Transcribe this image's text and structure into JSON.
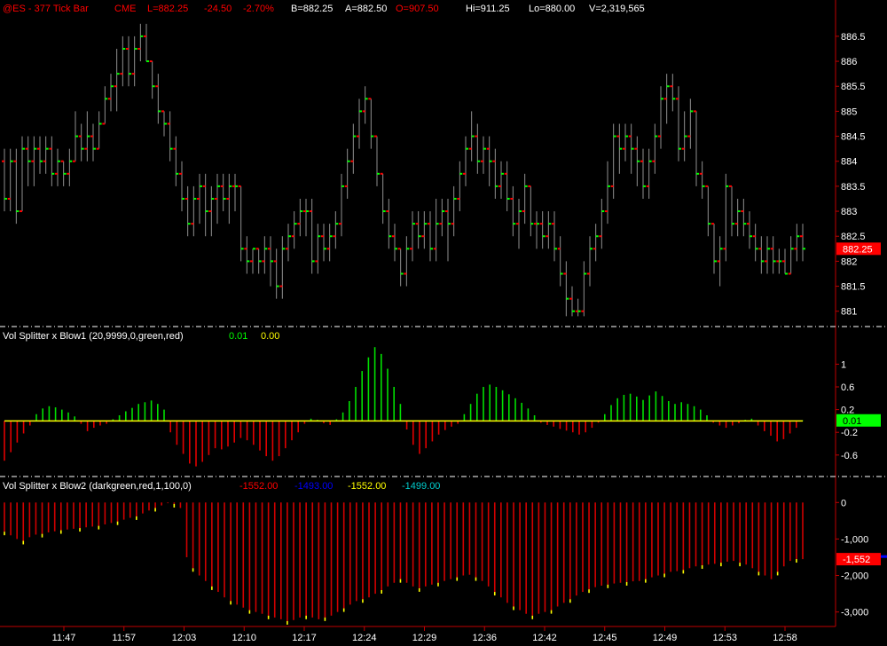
{
  "header": {
    "symbol": "@ES - 377 Tick Bar",
    "exchange": "CME",
    "last": "L=882.25",
    "net_change": "-24.50",
    "pct_change": "-2.70%",
    "bid": "B=882.25",
    "ask": "A=882.50",
    "open": "O=907.50",
    "high": "Hi=911.25",
    "low": "Lo=880.00",
    "volume": "V=2,319,565"
  },
  "colors": {
    "background": "#000000",
    "axis": "#c00000",
    "up_tick": "#00ff00",
    "down_tick": "#ff0000",
    "bar_stem": "#909090",
    "blow1_pos": "#00e000",
    "blow1_neg": "#e00000",
    "blow1_zero": "#ffff00",
    "blow2_bar": "#d00000",
    "blow2_tip": "#ffff00",
    "last_price_badge": "#ff0000",
    "blow1_badge": "#00ff00",
    "blow2_badge": "#ff0000",
    "blow2_ref": "#0000ff"
  },
  "panels": {
    "blow1": {
      "title": "Vol Splitter x Blow1 (20,9999,0,green,red)",
      "v1": "0.01",
      "v2": "0.00"
    },
    "blow2": {
      "title": "Vol Splitter x Blow2 (darkgreen,red,1,100,0)",
      "v1": "-1552.00",
      "v2": "-1493.00",
      "v3": "-1552.00",
      "v4": "-1499.00"
    }
  },
  "chart_data": [
    {
      "type": "ohlc",
      "name": "price",
      "ylim": [
        880.8,
        886.8
      ],
      "yticks": [
        "886.5",
        "886",
        "885.5",
        "885",
        "884.5",
        "884",
        "883.5",
        "883",
        "882.5",
        "882",
        "881.5",
        "881"
      ],
      "ytick_values": [
        886.5,
        886,
        885.5,
        885,
        884.5,
        884,
        883.5,
        883,
        882.5,
        882,
        881.5,
        881
      ],
      "last_label": "882.25",
      "last_value": 882.25,
      "bars": [
        [
          884.0,
          884.25,
          883.0,
          883.25
        ],
        [
          883.25,
          884.25,
          883.0,
          884.0
        ],
        [
          884.0,
          884.25,
          882.75,
          883.0
        ],
        [
          883.0,
          884.5,
          883.0,
          884.25
        ],
        [
          884.25,
          884.5,
          883.5,
          884.0
        ],
        [
          884.0,
          884.5,
          883.5,
          884.25
        ],
        [
          884.25,
          884.5,
          883.75,
          884.0
        ],
        [
          884.0,
          884.5,
          883.75,
          884.25
        ],
        [
          884.25,
          884.5,
          883.5,
          883.75
        ],
        [
          883.75,
          884.25,
          883.5,
          884.0
        ],
        [
          884.0,
          884.0,
          883.5,
          883.75
        ],
        [
          883.75,
          884.25,
          883.5,
          884.0
        ],
        [
          884.0,
          885.0,
          884.0,
          884.5
        ],
        [
          884.5,
          884.75,
          884.0,
          884.25
        ],
        [
          884.25,
          885.0,
          884.0,
          884.5
        ],
        [
          884.5,
          884.75,
          884.0,
          884.25
        ],
        [
          884.25,
          885.0,
          884.25,
          884.75
        ],
        [
          884.75,
          885.5,
          884.75,
          885.25
        ],
        [
          885.25,
          885.75,
          885.0,
          885.5
        ],
        [
          885.5,
          886.25,
          885.0,
          885.75
        ],
        [
          885.75,
          886.5,
          885.5,
          886.25
        ],
        [
          886.25,
          886.5,
          885.5,
          885.75
        ],
        [
          885.75,
          886.5,
          885.5,
          886.25
        ],
        [
          886.25,
          886.75,
          886.0,
          886.5
        ],
        [
          886.5,
          886.75,
          886.0,
          886.0
        ],
        [
          886.0,
          886.0,
          885.25,
          885.5
        ],
        [
          885.5,
          885.75,
          884.75,
          885.0
        ],
        [
          885.0,
          885.0,
          884.5,
          884.75
        ],
        [
          884.75,
          885.0,
          884.0,
          884.25
        ],
        [
          884.25,
          884.5,
          883.5,
          883.75
        ],
        [
          883.75,
          884.0,
          883.0,
          883.25
        ],
        [
          883.25,
          883.5,
          882.5,
          882.75
        ],
        [
          882.75,
          883.5,
          882.5,
          883.25
        ],
        [
          883.25,
          883.75,
          882.75,
          883.5
        ],
        [
          883.5,
          883.75,
          882.5,
          883.0
        ],
        [
          883.0,
          883.5,
          882.5,
          883.25
        ],
        [
          883.25,
          883.75,
          882.75,
          883.5
        ],
        [
          883.5,
          883.75,
          883.0,
          883.25
        ],
        [
          883.25,
          883.75,
          882.75,
          883.5
        ],
        [
          883.5,
          883.75,
          883.0,
          883.5
        ],
        [
          883.5,
          883.5,
          882.0,
          882.25
        ],
        [
          882.25,
          882.5,
          881.75,
          882.0
        ],
        [
          882.0,
          882.25,
          881.75,
          882.25
        ],
        [
          882.25,
          882.25,
          881.75,
          882.0
        ],
        [
          882.0,
          882.5,
          881.75,
          882.25
        ],
        [
          882.25,
          882.5,
          881.5,
          882.0
        ],
        [
          882.0,
          882.25,
          881.25,
          881.5
        ],
        [
          881.5,
          882.5,
          881.25,
          882.25
        ],
        [
          882.25,
          882.75,
          882.0,
          882.5
        ],
        [
          882.5,
          883.0,
          882.25,
          882.75
        ],
        [
          882.75,
          883.25,
          882.5,
          883.0
        ],
        [
          883.0,
          883.25,
          882.5,
          883.0
        ],
        [
          883.0,
          883.25,
          881.75,
          882.0
        ],
        [
          882.0,
          882.75,
          881.75,
          882.5
        ],
        [
          882.5,
          882.75,
          882.0,
          882.25
        ],
        [
          882.25,
          882.75,
          882.0,
          882.5
        ],
        [
          882.5,
          883.0,
          882.25,
          882.75
        ],
        [
          882.75,
          883.75,
          882.5,
          883.5
        ],
        [
          883.5,
          884.25,
          883.25,
          884.0
        ],
        [
          884.0,
          884.75,
          883.75,
          884.5
        ],
        [
          884.5,
          885.25,
          884.25,
          885.0
        ],
        [
          885.0,
          885.5,
          884.75,
          885.25
        ],
        [
          885.25,
          885.25,
          884.25,
          884.5
        ],
        [
          884.5,
          884.5,
          883.5,
          883.75
        ],
        [
          883.75,
          883.75,
          882.75,
          883.0
        ],
        [
          883.0,
          883.25,
          882.25,
          882.5
        ],
        [
          882.5,
          882.75,
          882.0,
          882.25
        ],
        [
          882.25,
          882.25,
          881.5,
          881.75
        ],
        [
          881.75,
          882.5,
          881.5,
          882.25
        ],
        [
          882.25,
          883.0,
          882.0,
          882.75
        ],
        [
          882.75,
          883.0,
          882.25,
          882.5
        ],
        [
          882.5,
          883.0,
          882.25,
          882.75
        ],
        [
          882.75,
          883.0,
          882.0,
          882.25
        ],
        [
          882.25,
          883.25,
          882.0,
          882.75
        ],
        [
          882.75,
          883.25,
          882.5,
          883.0
        ],
        [
          883.0,
          883.25,
          882.0,
          882.75
        ],
        [
          882.75,
          883.5,
          882.5,
          883.25
        ],
        [
          883.25,
          884.0,
          883.0,
          883.75
        ],
        [
          883.75,
          884.5,
          883.5,
          884.25
        ],
        [
          884.25,
          885.0,
          884.0,
          884.5
        ],
        [
          884.5,
          884.75,
          883.75,
          884.0
        ],
        [
          884.0,
          884.5,
          883.75,
          884.25
        ],
        [
          884.25,
          884.5,
          883.5,
          884.0
        ],
        [
          884.0,
          884.25,
          883.25,
          883.5
        ],
        [
          883.5,
          884.0,
          883.25,
          883.75
        ],
        [
          883.75,
          884.0,
          883.0,
          883.25
        ],
        [
          883.25,
          883.5,
          882.5,
          882.75
        ],
        [
          882.75,
          883.25,
          882.25,
          883.0
        ],
        [
          883.0,
          883.75,
          882.75,
          883.5
        ],
        [
          883.5,
          883.5,
          882.5,
          882.75
        ],
        [
          882.75,
          883.0,
          882.25,
          882.75
        ],
        [
          882.75,
          883.0,
          882.25,
          882.5
        ],
        [
          882.5,
          883.0,
          882.25,
          882.75
        ],
        [
          882.75,
          883.0,
          882.0,
          882.25
        ],
        [
          882.25,
          882.5,
          881.5,
          881.75
        ],
        [
          881.75,
          882.0,
          880.9,
          881.25
        ],
        [
          881.25,
          881.5,
          880.9,
          881.0
        ],
        [
          881.0,
          881.25,
          880.9,
          881.0
        ],
        [
          881.0,
          882.0,
          880.9,
          881.75
        ],
        [
          881.75,
          882.5,
          881.5,
          882.25
        ],
        [
          882.25,
          882.75,
          882.0,
          882.5
        ],
        [
          882.5,
          883.25,
          882.25,
          883.0
        ],
        [
          883.0,
          884.0,
          882.75,
          883.5
        ],
        [
          883.5,
          884.75,
          883.25,
          884.5
        ],
        [
          884.5,
          884.75,
          883.75,
          884.25
        ],
        [
          884.25,
          884.75,
          884.0,
          884.5
        ],
        [
          884.5,
          884.75,
          883.75,
          884.25
        ],
        [
          884.25,
          884.5,
          883.5,
          884.0
        ],
        [
          884.0,
          884.25,
          883.25,
          883.5
        ],
        [
          883.5,
          884.25,
          883.25,
          884.0
        ],
        [
          884.0,
          884.75,
          883.75,
          884.5
        ],
        [
          884.5,
          885.5,
          884.25,
          885.25
        ],
        [
          885.25,
          885.75,
          884.75,
          885.5
        ],
        [
          885.5,
          885.75,
          885.0,
          885.25
        ],
        [
          885.25,
          885.5,
          884.0,
          884.25
        ],
        [
          884.25,
          885.0,
          884.0,
          884.5
        ],
        [
          884.5,
          885.25,
          884.25,
          885.0
        ],
        [
          885.0,
          885.0,
          883.5,
          883.75
        ],
        [
          883.75,
          884.0,
          883.25,
          883.5
        ],
        [
          883.5,
          883.5,
          882.5,
          882.75
        ],
        [
          882.75,
          882.75,
          881.75,
          882.0
        ],
        [
          882.0,
          882.5,
          881.5,
          882.25
        ],
        [
          882.25,
          883.75,
          882.0,
          883.5
        ],
        [
          883.5,
          883.5,
          882.5,
          882.75
        ],
        [
          882.75,
          883.25,
          882.5,
          883.0
        ],
        [
          883.0,
          883.25,
          882.5,
          882.75
        ],
        [
          882.75,
          883.0,
          882.25,
          882.5
        ],
        [
          882.5,
          882.75,
          882.0,
          882.25
        ],
        [
          882.25,
          882.5,
          881.75,
          882.0
        ],
        [
          882.0,
          882.5,
          881.75,
          882.25
        ],
        [
          882.25,
          882.5,
          881.75,
          882.0
        ],
        [
          882.0,
          882.25,
          881.75,
          882.0
        ],
        [
          882.0,
          882.25,
          881.75,
          881.75
        ],
        [
          881.75,
          882.5,
          881.75,
          882.25
        ],
        [
          882.25,
          882.75,
          882.0,
          882.5
        ],
        [
          882.5,
          882.75,
          882.0,
          882.25
        ]
      ],
      "xtick_labels": [
        "11:47",
        "11:57",
        "12:03",
        "12:10",
        "12:17",
        "12:24",
        "12:29",
        "12:36",
        "12:42",
        "12:45",
        "12:49",
        "12:53",
        "12:58"
      ]
    },
    {
      "type": "bar",
      "name": "blow1",
      "title": "Vol Splitter x Blow1 (20,9999,0,green,red)",
      "ylim": [
        -0.9,
        1.35
      ],
      "yticks": [
        "1",
        "0.6",
        "0.2",
        "-0.2",
        "-0.6"
      ],
      "ytick_values": [
        1,
        0.6,
        0.2,
        -0.2,
        -0.6
      ],
      "last_label": "0.01",
      "last_value": 0.01,
      "values": [
        -0.7,
        -0.55,
        -0.38,
        -0.22,
        -0.08,
        0.12,
        0.22,
        0.26,
        0.24,
        0.2,
        0.15,
        0.08,
        -0.05,
        -0.18,
        -0.12,
        -0.08,
        -0.05,
        0.03,
        0.1,
        0.17,
        0.23,
        0.3,
        0.33,
        0.36,
        0.3,
        0.2,
        -0.2,
        -0.42,
        -0.58,
        -0.75,
        -0.8,
        -0.72,
        -0.6,
        -0.48,
        -0.5,
        -0.45,
        -0.38,
        -0.3,
        -0.34,
        -0.42,
        -0.52,
        -0.62,
        -0.7,
        -0.62,
        -0.48,
        -0.34,
        -0.2,
        -0.05,
        0.04,
        0.02,
        -0.04,
        -0.07,
        0.03,
        0.15,
        0.35,
        0.6,
        0.88,
        1.12,
        1.3,
        1.18,
        0.92,
        0.6,
        0.3,
        -0.15,
        -0.42,
        -0.58,
        -0.48,
        -0.36,
        -0.24,
        -0.16,
        -0.1,
        -0.05,
        0.12,
        0.3,
        0.48,
        0.6,
        0.64,
        0.6,
        0.54,
        0.47,
        0.4,
        0.32,
        0.22,
        0.1,
        -0.03,
        -0.07,
        -0.1,
        -0.14,
        -0.17,
        -0.2,
        -0.24,
        -0.2,
        -0.12,
        -0.03,
        0.12,
        0.28,
        0.4,
        0.46,
        0.48,
        0.43,
        0.37,
        0.45,
        0.52,
        0.44,
        0.35,
        0.3,
        0.33,
        0.3,
        0.26,
        0.2,
        0.1,
        -0.03,
        -0.08,
        -0.12,
        -0.08,
        -0.04,
        0.02,
        0.04,
        -0.08,
        -0.18,
        -0.26,
        -0.36,
        -0.32,
        -0.22,
        -0.12,
        0.01
      ],
      "zero_line": 0
    },
    {
      "type": "bar",
      "name": "blow2",
      "title": "Vol Splitter x Blow2 (darkgreen,red,1,100,0)",
      "ylim": [
        -3300,
        250
      ],
      "yticks": [
        "0",
        "-1,000",
        "-2,000",
        "-3,000"
      ],
      "ytick_values": [
        0,
        -1000,
        -2000,
        -3000
      ],
      "last_label": "-1,552",
      "last_value": -1552,
      "ref_value": -1493,
      "values": [
        -800,
        -900,
        -1000,
        -1050,
        -950,
        -880,
        -860,
        -820,
        -790,
        -760,
        -740,
        -720,
        -700,
        -680,
        -660,
        -640,
        -600,
        -560,
        -520,
        -470,
        -420,
        -380,
        -300,
        -220,
        -150,
        -80,
        -20,
        -40,
        -150,
        -1500,
        -1800,
        -2000,
        -2150,
        -2300,
        -2450,
        -2600,
        -2700,
        -2800,
        -2880,
        -2950,
        -3000,
        -3050,
        -3100,
        -3150,
        -3200,
        -3250,
        -3220,
        -3150,
        -3100,
        -3150,
        -3200,
        -3150,
        -3100,
        -3000,
        -2900,
        -2800,
        -2700,
        -2650,
        -2600,
        -2500,
        -2400,
        -2300,
        -2200,
        -2100,
        -2200,
        -2300,
        -2350,
        -2300,
        -2250,
        -2200,
        -2150,
        -2100,
        -2050,
        -2000,
        -1980,
        -2050,
        -2150,
        -2300,
        -2450,
        -2600,
        -2750,
        -2850,
        -2950,
        -3050,
        -3100,
        -3050,
        -3000,
        -2950,
        -2850,
        -2750,
        -2650,
        -2550,
        -2450,
        -2380,
        -2320,
        -2280,
        -2250,
        -2220,
        -2200,
        -2180,
        -2160,
        -2150,
        -2100,
        -2050,
        -2000,
        -1950,
        -1900,
        -1880,
        -1850,
        -1800,
        -1750,
        -1720,
        -1700,
        -1680,
        -1650,
        -1620,
        -1600,
        -1650,
        -1700,
        -1800,
        -1900,
        -2000,
        -2100,
        -1900,
        -1750,
        -1600,
        -1550,
        -1552
      ]
    }
  ]
}
